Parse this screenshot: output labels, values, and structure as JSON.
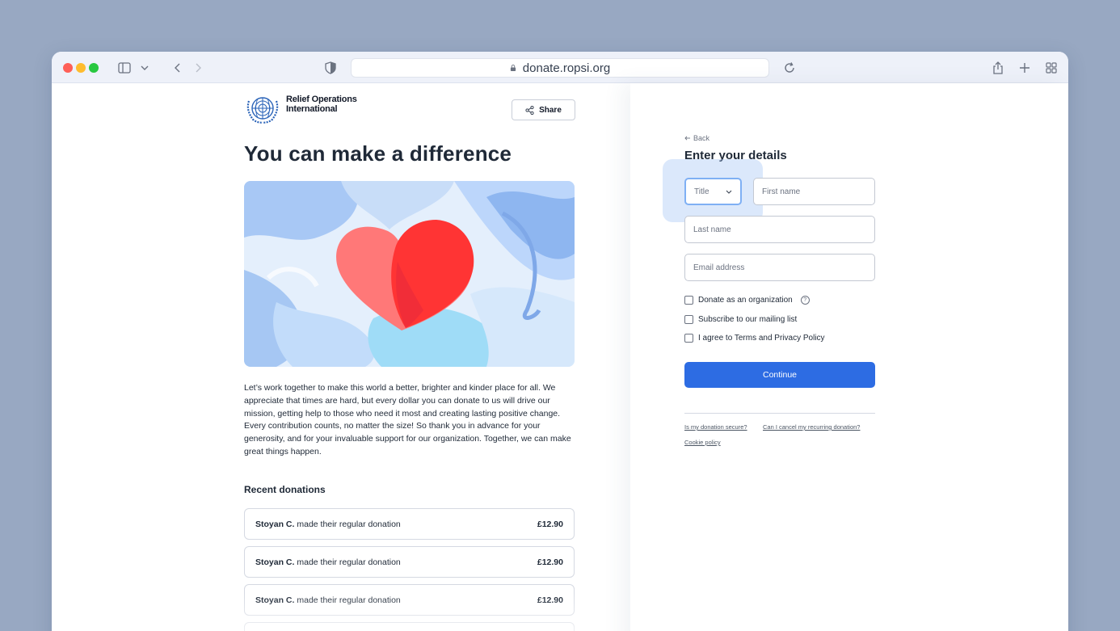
{
  "browser": {
    "url": "donate.ropsi.org"
  },
  "org": {
    "name_line1": "Relief Operations",
    "name_line2": "International"
  },
  "header": {
    "share_label": "Share"
  },
  "main": {
    "headline": "You can make a difference",
    "body": "Let’s work together to make this world a better, brighter and kinder place for all. We appreciate that times are hard, but every dollar you can donate to us will drive our mission, getting help to those who need it most and creating lasting positive change. Every contribution counts, no matter the size! So thank you in advance for your generosity, and for your invaluable support for our organization. Together, we can make great things happen.",
    "recent_title": "Recent donations",
    "donations": [
      {
        "donor": "Stoyan C.",
        "text": "made their regular donation",
        "amount": "£12.90"
      },
      {
        "donor": "Stoyan C.",
        "text": "made their regular donation",
        "amount": "£12.90"
      },
      {
        "donor": "Stoyan C.",
        "text": "made their regular donation",
        "amount": "£12.90"
      }
    ]
  },
  "form": {
    "back_label": "Back",
    "title": "Enter your details",
    "title_select_value": "Title",
    "first_name_placeholder": "First name",
    "last_name_placeholder": "Last name",
    "email_placeholder": "Email address",
    "checkboxes": [
      {
        "label": "Donate as an organization",
        "checked": false
      },
      {
        "label": "Subscribe to our mailing list",
        "checked": false
      },
      {
        "label": "I agree to Terms and Privacy Policy",
        "checked": false
      }
    ],
    "continue_label": "Continue",
    "links": [
      "Is my donation secure?",
      "Can I cancel my recurring donation?",
      "Cookie policy"
    ]
  },
  "colors": {
    "accent": "#2d6ce3",
    "background": "#98a8c2",
    "heart": "#ff3a3a"
  },
  "icons": [
    "sidebar-icon",
    "chevron-down-icon",
    "back-arrow-icon",
    "forward-arrow-icon",
    "shield-icon",
    "lock-icon",
    "reload-icon",
    "share-icon",
    "plus-icon",
    "tabs-grid-icon",
    "help-icon"
  ]
}
